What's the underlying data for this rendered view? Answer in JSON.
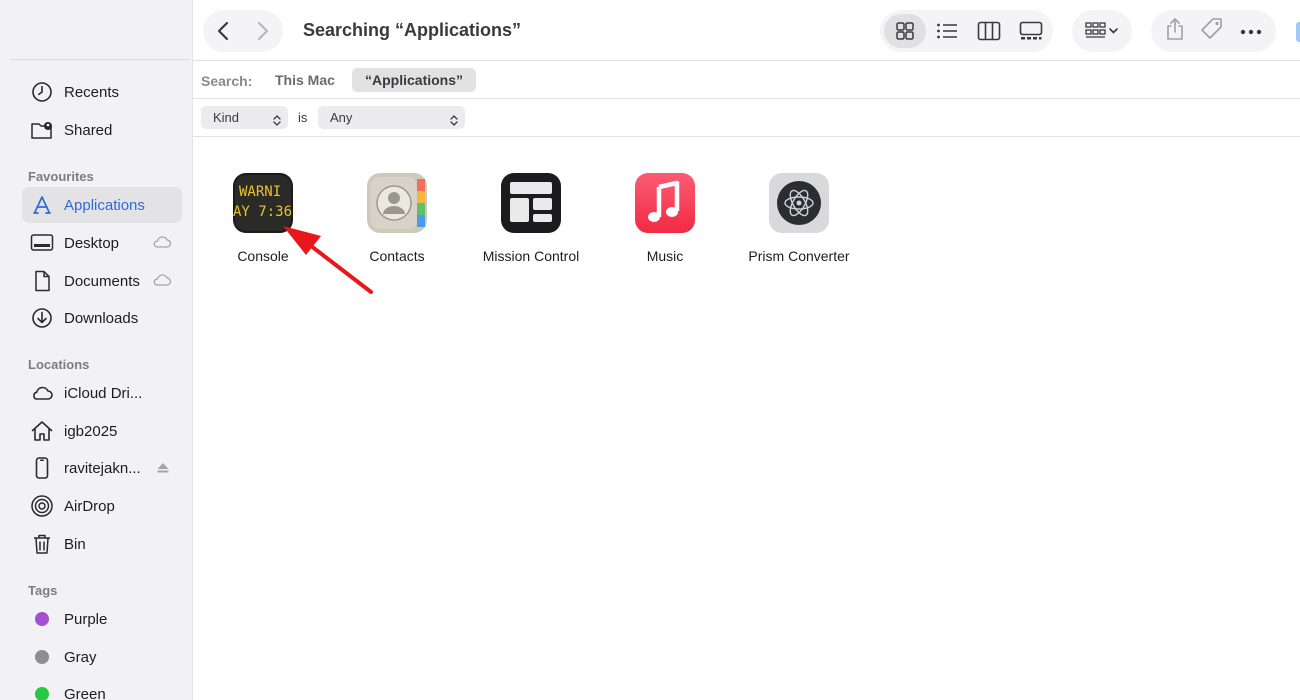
{
  "toolbar": {
    "title": "Searching “Applications”",
    "back_icon": "chevron-left-icon",
    "forward_icon": "chevron-right-icon",
    "view_modes": [
      "icon-view",
      "list-view",
      "column-view",
      "gallery-view"
    ],
    "selected_view": "icon-view",
    "group_icon": "group-by-icon",
    "actions": [
      "share-icon",
      "tag-icon",
      "more-icon"
    ]
  },
  "scope": {
    "label": "Search:",
    "this_mac": "This Mac",
    "applications": "“Applications”"
  },
  "criteria": {
    "attribute": "Kind",
    "operator": "is",
    "value": "Any"
  },
  "sidebar": {
    "top_items": [
      {
        "label": "Recents",
        "icon": "clock-icon"
      },
      {
        "label": "Shared",
        "icon": "shared-folder-icon"
      }
    ],
    "favourites_header": "Favourites",
    "favourites": [
      {
        "label": "Applications",
        "icon": "applications-icon",
        "active": true
      },
      {
        "label": "Desktop",
        "icon": "desktop-icon",
        "cloud": true
      },
      {
        "label": "Documents",
        "icon": "document-icon",
        "cloud": true
      },
      {
        "label": "Downloads",
        "icon": "download-icon"
      }
    ],
    "locations_header": "Locations",
    "locations": [
      {
        "label": "iCloud Dri...",
        "icon": "cloud-icon"
      },
      {
        "label": "igb2025",
        "icon": "home-icon"
      },
      {
        "label": "ravitejakn...",
        "icon": "iphone-icon",
        "eject": true
      },
      {
        "label": "AirDrop",
        "icon": "airdrop-icon"
      },
      {
        "label": "Bin",
        "icon": "trash-icon"
      }
    ],
    "tags_header": "Tags",
    "tags": [
      {
        "label": "Purple",
        "color": "#a550d2"
      },
      {
        "label": "Gray",
        "color": "#8e8e92"
      },
      {
        "label": "Green",
        "color": "#28c840"
      }
    ]
  },
  "apps": [
    {
      "name": "Console",
      "icon": "console-icon",
      "icon_text_1": "WARNI",
      "icon_text_2": "AY 7:36"
    },
    {
      "name": "Contacts",
      "icon": "contacts-icon"
    },
    {
      "name": "Mission Control",
      "icon": "mission-control-icon"
    },
    {
      "name": "Music",
      "icon": "music-icon"
    },
    {
      "name": "Prism Converter",
      "icon": "prism-converter-icon"
    }
  ],
  "annotation": {
    "type": "red-arrow",
    "target": "Console",
    "color": "#e8171b"
  },
  "colors": {
    "accent": "#2f6bd8",
    "sidebar_bg": "#f2f2f4"
  }
}
